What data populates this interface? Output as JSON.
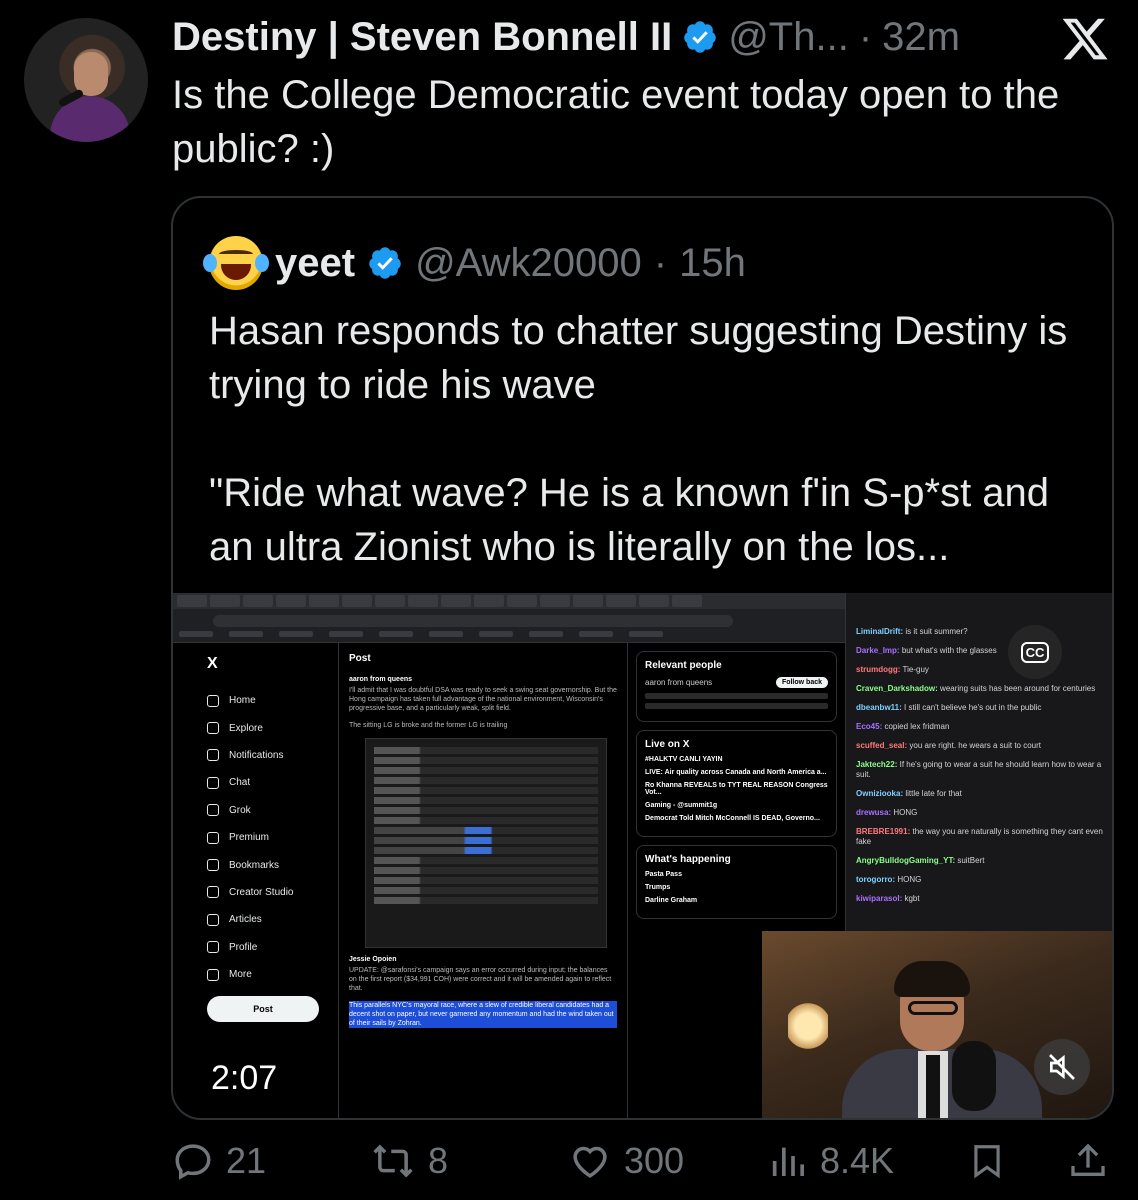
{
  "tweet": {
    "author_name": "Destiny | Steven Bonnell II",
    "handle": "@Th...",
    "separator": "·",
    "time": "32m",
    "text": "Is the College Democratic event today open to the public? :)"
  },
  "quoted": {
    "author_name": "yeet",
    "handle": "@Awk20000",
    "separator": "·",
    "time": "15h",
    "text": "Hasan responds to chatter suggesting Destiny is trying to ride his wave\n\n\"Ride what wave? He is a known f'in S-p*st and an ultra Zionist who is literally on the los..."
  },
  "video": {
    "timestamp": "2:07",
    "embedded": {
      "nav": [
        "Home",
        "Explore",
        "Notifications",
        "Chat",
        "Grok",
        "Premium",
        "Bookmarks",
        "Creator Studio",
        "Articles",
        "Profile",
        "More"
      ],
      "post_button": "Post",
      "post_title": "Post",
      "author_line": "aaron from queens",
      "para1": "I'll admit that I was doubtful DSA was ready to seek a swing seat governorship. But the Hong campaign has taken full advantage of the national environment, Wisconsin's progressive base, and a particularly weak, split field.",
      "para2": "The sitting LG is broke and the former LG is trailing",
      "author2": "Jessie Opoien",
      "para3": "UPDATE: @sarafonsi's campaign says an error occurred during input; the balances on the first report ($34,991 COH) were correct and it will be amended again to reflect that.",
      "highlight": "This parallels NYC's mayoral race, where a slew of credible liberal candidates had a decent shot on paper, but never garnered any momentum and had the wind taken out of their sails by Zohran.",
      "relevant_title": "Relevant people",
      "follow_back": "Follow back",
      "live_title": "Live on X",
      "live_items": [
        "#HALKTV CANLI YAYIN",
        "LIVE: Air quality across Canada and North America a...",
        "Ro Khanna REVEALS to TYT REAL REASON Congress Vot...",
        "Gaming - @summit1g",
        "Democrat Told Mitch McConnell IS DEAD, Governo..."
      ],
      "happening_title": "What's happening",
      "happening_items": [
        "Pasta Pass",
        "Trumps",
        "Darline Graham"
      ],
      "chat": [
        {
          "user": "LiminalDrift:",
          "msg": "is it suit summer?"
        },
        {
          "user": "Darke_Imp:",
          "msg": "but what's with the glasses"
        },
        {
          "user": "strumdogg:",
          "msg": "Tie-guy"
        },
        {
          "user": "Craven_Darkshadow:",
          "msg": "wearing suits has been around for centuries"
        },
        {
          "user": "dbeanbw11:",
          "msg": "I still can't believe he's out in the public"
        },
        {
          "user": "Eco45:",
          "msg": "copied lex fridman"
        },
        {
          "user": "scuffed_seal:",
          "msg": "you are right. he wears a suit to court"
        },
        {
          "user": "Jaktech22:",
          "msg": "If he's going to wear a suit he should learn how to wear a suit."
        },
        {
          "user": "Owniziooka:",
          "msg": "little late for that"
        },
        {
          "user": "drewusa:",
          "msg": "HONG"
        },
        {
          "user": "BREBRE1991:",
          "msg": "the way you are naturally is something they cant even fake"
        },
        {
          "user": "AngryBulldogGaming_YT:",
          "msg": "suitBert"
        },
        {
          "user": "torogorro:",
          "msg": "HONG"
        },
        {
          "user": "kiwiparasol:",
          "msg": "kgbt"
        }
      ],
      "cc_label": "CC"
    }
  },
  "actions": {
    "replies": "21",
    "reposts": "8",
    "likes": "300",
    "views": "8.4K"
  },
  "colors": {
    "background": "#000000",
    "text": "#e7e9ea",
    "muted": "#71767b",
    "verified": "#1d9bf0",
    "border": "#2f3336"
  }
}
